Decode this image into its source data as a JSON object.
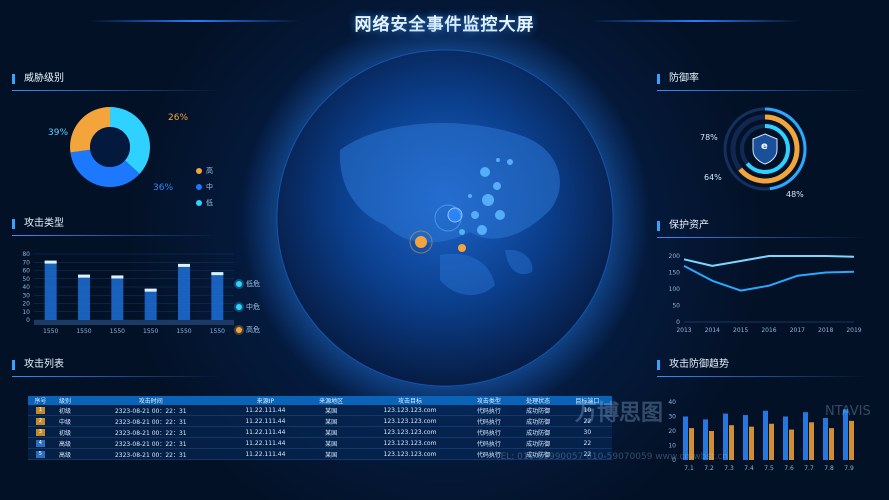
{
  "title": "网络安全事件监控大屏",
  "panels": {
    "threat_level": "威胁级别",
    "attack_type": "攻击类型",
    "attack_list": "攻击列表",
    "defense_rate": "防御率",
    "protect_assets": "保护资产",
    "defense_trend": "攻击防御趋势"
  },
  "threat": {
    "pct_left": "39%",
    "pct_top": "26%",
    "pct_bottom": "36%",
    "legend": [
      "高",
      "中",
      "低"
    ],
    "colors": {
      "high": "#f3a53b",
      "mid": "#1b78ff",
      "low": "#2ed1ff"
    }
  },
  "attack_type_legend": [
    "低危",
    "中危",
    "高危"
  ],
  "defense": {
    "icon": "e",
    "p78": "78%",
    "p64": "64%",
    "p48": "48%"
  },
  "chart_data": [
    {
      "type": "bar",
      "categories": [
        "1550",
        "1550",
        "1550",
        "1550",
        "1550",
        "1550"
      ],
      "values": [
        72,
        55,
        54,
        38,
        68,
        58
      ],
      "yticks": [
        "0",
        "10",
        "20",
        "30",
        "40",
        "50",
        "60",
        "70",
        "80"
      ],
      "ylim": [
        0,
        80
      ]
    },
    {
      "type": "line",
      "x": [
        "2013",
        "2014",
        "2015",
        "2016",
        "2017",
        "2018",
        "2019"
      ],
      "yticks": [
        "0",
        "50",
        "100",
        "150",
        "200"
      ],
      "ylim": [
        0,
        200
      ],
      "series": [
        {
          "values": [
            190,
            170,
            185,
            200,
            210,
            205,
            198
          ]
        },
        {
          "values": [
            170,
            125,
            95,
            110,
            140,
            150,
            152
          ]
        }
      ]
    },
    {
      "type": "bar",
      "x": [
        "7.1",
        "7.2",
        "7.3",
        "7.4",
        "7.5",
        "7.6",
        "7.7",
        "7.8",
        "7.9"
      ],
      "yticks": [
        "0",
        "10",
        "20",
        "30",
        "40"
      ],
      "ylim": [
        0,
        40
      ],
      "series": [
        {
          "values": [
            30,
            28,
            32,
            31,
            34,
            30,
            33,
            29,
            35
          ]
        },
        {
          "values": [
            22,
            20,
            24,
            23,
            25,
            21,
            26,
            22,
            27
          ]
        }
      ]
    }
  ],
  "table": {
    "headers": [
      "序号",
      "级别",
      "攻击时间",
      "来源IP",
      "来源地区",
      "攻击目标",
      "攻击类型",
      "处理状态",
      "目标端口"
    ],
    "rows": [
      [
        "1",
        "初级",
        "2323-08-21 00：22：31",
        "11.22.111.44",
        "某国",
        "123.123.123.com",
        "代码执行",
        "成功防御",
        "10"
      ],
      [
        "2",
        "中级",
        "2323-08-21 00：22：31",
        "11.22.111.44",
        "某国",
        "123.123.123.com",
        "代码执行",
        "成功防御",
        "22"
      ],
      [
        "3",
        "初级",
        "2323-08-21 00：22：31",
        "11.22.111.44",
        "某国",
        "123.123.123.com",
        "代码执行",
        "成功防御",
        "30"
      ],
      [
        "4",
        "高级",
        "2323-08-21 00：22：31",
        "11.22.111.44",
        "某国",
        "123.123.123.com",
        "代码执行",
        "成功防御",
        "22"
      ],
      [
        "5",
        "高级",
        "2323-08-21 00：22：31",
        "11.22.111.44",
        "某国",
        "123.123.123.com",
        "代码执行",
        "成功防御",
        "22"
      ]
    ]
  },
  "watermark": {
    "cn": "万博思图",
    "en": "NTAVIS",
    "tel": "TEL: 010-65990057 010-59070059 www.cn-wbst.cn"
  }
}
